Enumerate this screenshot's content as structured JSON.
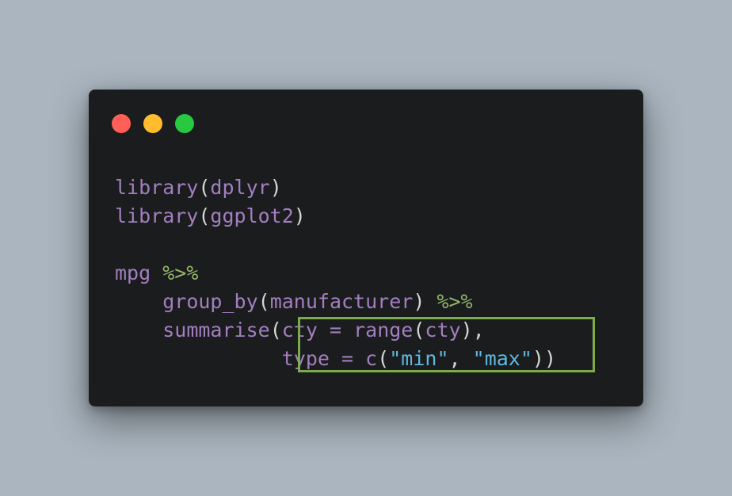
{
  "window": {
    "buttons": [
      "close",
      "minimize",
      "maximize"
    ]
  },
  "code": {
    "line1": {
      "kw": "library",
      "open": "(",
      "arg": "dplyr",
      "close": ")"
    },
    "line2": {
      "kw": "library",
      "open": "(",
      "arg": "ggplot2",
      "close": ")"
    },
    "line4": {
      "name": "mpg",
      "pipe": "%>%"
    },
    "line5": {
      "fn": "group_by",
      "open": "(",
      "arg": "manufacturer",
      "close": ")",
      "pipe": "%>%"
    },
    "line6": {
      "fn": "summarise",
      "open": "(",
      "col": "cty",
      "eq": "=",
      "fn2": "range",
      "open2": "(",
      "arg": "cty",
      "close": "),"
    },
    "line7": {
      "col": "type",
      "eq": "=",
      "fn": "c",
      "open": "(",
      "s1": "\"min\"",
      "comma": ",",
      "s2": "\"max\"",
      "close": "))"
    }
  },
  "colors": {
    "background": "#aab5bf",
    "editor": "#1b1c1e",
    "function": "#a27fc0",
    "punctuation": "#d6d6d6",
    "operator": "#94b86a",
    "string": "#5fb7e0",
    "highlight_border": "#7bab4a"
  }
}
